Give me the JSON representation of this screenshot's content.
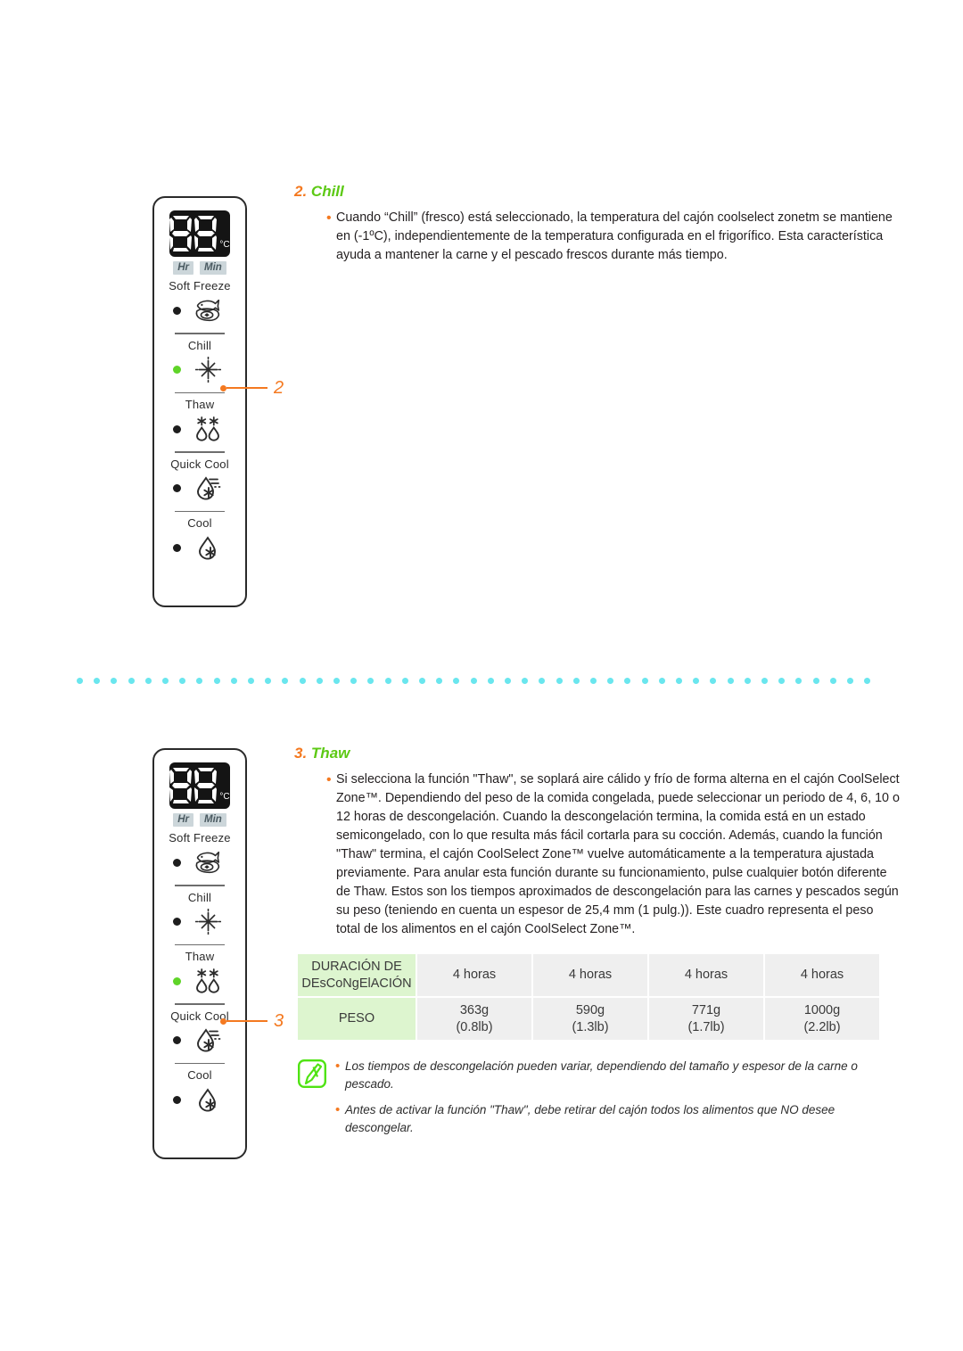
{
  "panels": [
    {
      "name": "panel-chill",
      "display": {
        "value": "88",
        "unit": "°C"
      },
      "timer_labels": {
        "hr": "Hr",
        "min": "Min"
      },
      "functions": [
        {
          "label": "Soft Freeze",
          "icon": "fish-steak-icon",
          "led": "off"
        },
        {
          "label": "Chill",
          "icon": "chill-star-icon",
          "led": "on"
        },
        {
          "label": "Thaw",
          "icon": "thaw-drops-icon",
          "led": "off"
        },
        {
          "label": "Quick Cool",
          "icon": "quick-cool-droplet-icon",
          "led": "off"
        },
        {
          "label": "Cool",
          "icon": "cool-droplet-icon",
          "led": "off"
        }
      ],
      "callout": "2"
    },
    {
      "name": "panel-thaw",
      "display": {
        "value": "88",
        "unit": "°C"
      },
      "timer_labels": {
        "hr": "Hr",
        "min": "Min"
      },
      "functions": [
        {
          "label": "Soft Freeze",
          "icon": "fish-steak-icon",
          "led": "off"
        },
        {
          "label": "Chill",
          "icon": "chill-star-icon",
          "led": "off"
        },
        {
          "label": "Thaw",
          "icon": "thaw-drops-icon",
          "led": "on"
        },
        {
          "label": "Quick Cool",
          "icon": "quick-cool-droplet-icon",
          "led": "off"
        },
        {
          "label": "Cool",
          "icon": "cool-droplet-icon",
          "led": "off"
        }
      ],
      "callout": "3"
    }
  ],
  "sections": {
    "chill": {
      "number": "2.",
      "title": "Chill",
      "bullet": "Cuando “Chill” (fresco) está seleccionado, la temperatura del cajón coolselect zonetm se mantiene en (-1ºC), independientemente de la temperatura configurada en el frigorífico. Esta característica ayuda a mantener la carne y el pescado frescos durante más tiempo."
    },
    "thaw": {
      "number": "3.",
      "title": "Thaw",
      "bullet": "Si selecciona la función \"Thaw\", se soplará aire cálido y frío de forma alterna en el cajón CoolSelect Zone™. Dependiendo del peso de la comida congelada, puede seleccionar un periodo de 4, 6, 10 o 12 horas de descongelación. Cuando la descongelación termina, la comida está en un estado semicongelado, con lo que resulta más fácil cortarla para su cocción. Además, cuando la función \"Thaw\" termina, el cajón CoolSelect Zone™ vuelve automáticamente a la temperatura ajustada previamente. Para anular esta función durante su funcionamiento, pulse cualquier botón diferente de Thaw. Estos son los tiempos aproximados de descongelación para las carnes y pescados según su peso (teniendo en cuenta un espesor de 25,4 mm (1 pulg.)). Este cuadro representa el peso total de los alimentos en el cajón CoolSelect Zone™."
    }
  },
  "table": {
    "row_headers": [
      "DURACIÓN DE DEsCoNgElACIÓN",
      "PESO"
    ],
    "duration": [
      "4 horas",
      "4 horas",
      "4 horas",
      "4 horas"
    ],
    "weight_g": [
      "363g",
      "590g",
      "771g",
      "1000g"
    ],
    "weight_lb": [
      "(0.8lb)",
      "(1.3lb)",
      "(1.7lb)",
      "(2.2lb)"
    ]
  },
  "notes": {
    "icon": "note-pencil-icon",
    "items": [
      "Los tiempos de descongelación pueden variar, dependiendo del tamaño y espesor de la carne o pescado.",
      "Antes de activar la función \"Thaw\", debe retirar del cajón todos los alimentos que NO desee descongelar."
    ]
  },
  "colors": {
    "accent_orange": "#f47920",
    "accent_green": "#5cc914",
    "led_on": "#5fd428",
    "dotted_separator": "#6ae6ee",
    "table_header_bg": "#ddf5cf",
    "table_cell_bg": "#efefef"
  }
}
